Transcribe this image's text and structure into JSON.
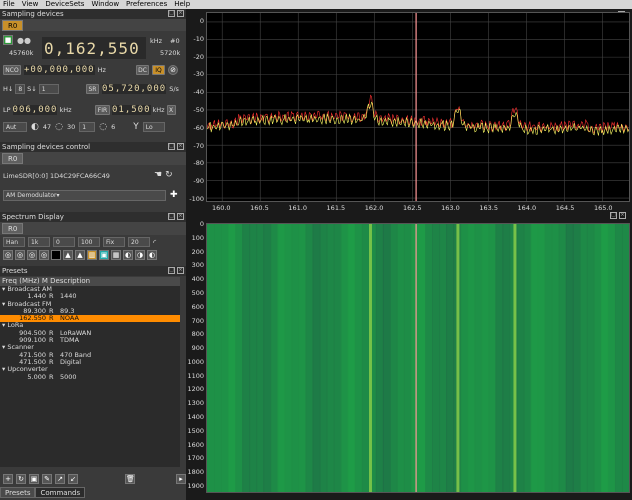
{
  "menu": [
    "File",
    "View",
    "DeviceSets",
    "Window",
    "Preferences",
    "Help"
  ],
  "sampling_devices": {
    "title": "Sampling devices",
    "tab": "R0",
    "freq_digits": "0,162,550",
    "freq_unit": "kHz",
    "freq_hash": "#0",
    "lo_limit": "45760k",
    "hi_limit": "5720k",
    "nco_label": "NCO",
    "nco_value": "+00,000,000",
    "nco_unit": "Hz",
    "dc_label": "DC",
    "iq_label": "IQ",
    "hi_label": "H↓",
    "hi_value": "8",
    "s_label": "S↓",
    "s_value": "1",
    "sr_label": "SR",
    "sr_value": "05,720,000",
    "sr_unit": "S/s",
    "lp_label": "LP",
    "lp_value": "006,000",
    "lp_unit": "kHz",
    "fir_label": "FIR",
    "fir_value": "01,500",
    "fir_unit": "kHz",
    "x_label": "X",
    "gain_mode": "Aut",
    "gain_value": "47",
    "lna_value": "30",
    "tia_value": "1",
    "pga_value": "6",
    "antenna": "Lo"
  },
  "sampling_control": {
    "title": "Sampling devices control",
    "tab": "R0",
    "device": "LimeSDR[0:0] 1D4C29FCA66C49",
    "demod": "AM Demodulator"
  },
  "spectrum_display": {
    "title": "Spectrum Display",
    "tab": "R0",
    "window": "Han",
    "fft": "1k",
    "ref": "0",
    "range": "100",
    "fix": "Fix",
    "avg": "20"
  },
  "presets": {
    "title": "Presets",
    "col_freq": "Freq (MHz)",
    "col_m": "M",
    "col_desc": "Description",
    "groups": [
      {
        "name": "Broadcast AM",
        "items": [
          {
            "freq": "1.440",
            "m": "R",
            "desc": "1440"
          }
        ]
      },
      {
        "name": "Broadcast FM",
        "items": [
          {
            "freq": "89.300",
            "m": "R",
            "desc": "89.3"
          },
          {
            "freq": "162.550",
            "m": "R",
            "desc": "NOAA",
            "selected": true
          }
        ]
      },
      {
        "name": "LoRa",
        "items": [
          {
            "freq": "904.500",
            "m": "R",
            "desc": "LoRaWAN"
          },
          {
            "freq": "909.100",
            "m": "R",
            "desc": "TDMA"
          }
        ]
      },
      {
        "name": "Scanner",
        "items": [
          {
            "freq": "471.500",
            "m": "R",
            "desc": "470 Band"
          },
          {
            "freq": "471.500",
            "m": "R",
            "desc": "Digital"
          }
        ]
      },
      {
        "name": "Upconverter",
        "items": [
          {
            "freq": "5.000",
            "m": "R",
            "desc": "5000"
          }
        ]
      }
    ]
  },
  "bottom_tabs": [
    "Presets",
    "Commands"
  ],
  "spectrum": {
    "y_ticks": [
      "0",
      "-10",
      "-20",
      "-30",
      "-40",
      "-50",
      "-60",
      "-70",
      "-80",
      "-90",
      "-100"
    ],
    "x_ticks": [
      "160.0",
      "160.5",
      "161.0",
      "161.5",
      "162.0",
      "162.5",
      "163.0",
      "163.5",
      "164.0",
      "164.5",
      "165.0"
    ],
    "center_freq_mhz": 162.55,
    "peaks_mhz": [
      161.95,
      163.1,
      163.85
    ]
  },
  "waterfall": {
    "y_ticks": [
      "0",
      "100",
      "200",
      "300",
      "400",
      "500",
      "600",
      "700",
      "800",
      "900",
      "1000",
      "1100",
      "1200",
      "1300",
      "1400",
      "1500",
      "1600",
      "1700",
      "1800",
      "1900"
    ]
  },
  "colors": {
    "accent_orange": "#ff8c00",
    "center_line": "#ff9999",
    "spectrum_trace": "#ffff66",
    "spectrum_max": "#ff3333",
    "waterfall_green": "#1f9a4a"
  }
}
